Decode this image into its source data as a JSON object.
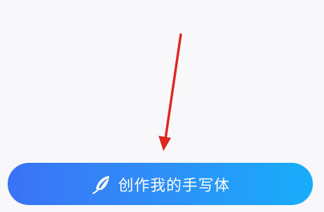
{
  "create_button": {
    "label": "创作我的手写体",
    "icon": "feather-icon"
  },
  "annotation": {
    "icon": "red-arrow-pointer",
    "color": "#e0271f"
  },
  "colors": {
    "background": "#f8f8fa",
    "button_gradient_start": "#3a72f6",
    "button_gradient_end": "#17adfb",
    "button_text": "#ffffff"
  }
}
